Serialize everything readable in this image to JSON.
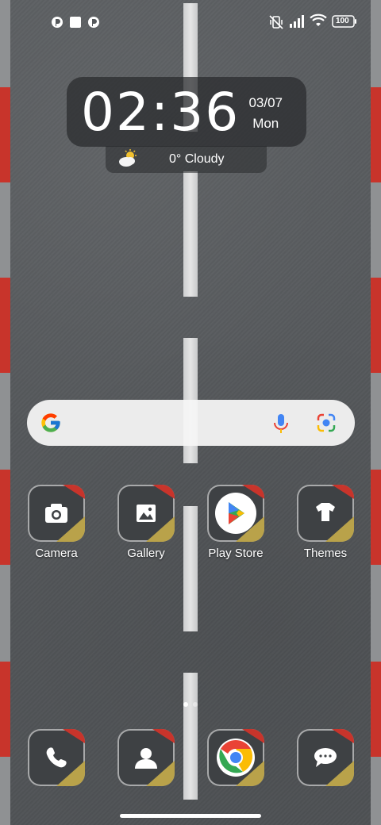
{
  "status_bar": {
    "notification_icons": [
      "notification-icon",
      "app-notification-icon",
      "notification-icon"
    ],
    "battery": "100"
  },
  "clock": {
    "time": "02:36",
    "date": "03/07",
    "weekday": "Mon"
  },
  "weather": {
    "text": "0° Cloudy",
    "icon": "partly-cloudy-icon"
  },
  "search_bar": {
    "logo": "google-logo",
    "mic": "mic-icon",
    "lens": "lens-icon"
  },
  "apps": [
    {
      "label": "Camera",
      "icon": "camera-icon"
    },
    {
      "label": "Gallery",
      "icon": "gallery-icon"
    },
    {
      "label": "Play Store",
      "icon": "play-store-icon"
    },
    {
      "label": "Themes",
      "icon": "themes-icon"
    }
  ],
  "dock": [
    {
      "icon": "phone-icon"
    },
    {
      "icon": "contacts-icon"
    },
    {
      "icon": "chrome-icon"
    },
    {
      "icon": "messages-icon"
    }
  ],
  "page_indicator": {
    "pages": 2,
    "current": 1
  },
  "colors": {
    "accent_red": "#c8342b",
    "accent_yellow": "#b9a24a",
    "road": "#55585b"
  }
}
